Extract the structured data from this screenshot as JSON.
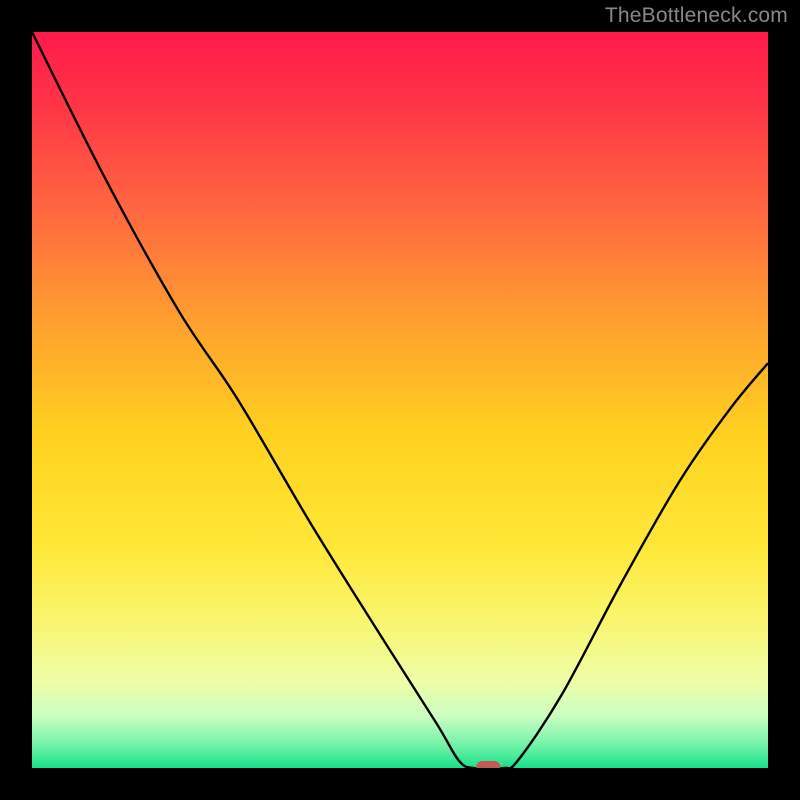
{
  "watermark": "TheBottleneck.com",
  "chart_data": {
    "type": "line",
    "title": "",
    "xlabel": "",
    "ylabel": "",
    "xlim": [
      0,
      100
    ],
    "ylim": [
      0,
      100
    ],
    "grid": false,
    "legend": false,
    "curve": [
      {
        "x": 0,
        "y": 100
      },
      {
        "x": 10,
        "y": 80
      },
      {
        "x": 20,
        "y": 62
      },
      {
        "x": 28,
        "y": 50
      },
      {
        "x": 38,
        "y": 33
      },
      {
        "x": 48,
        "y": 17
      },
      {
        "x": 55,
        "y": 6
      },
      {
        "x": 58,
        "y": 1
      },
      {
        "x": 60,
        "y": 0
      },
      {
        "x": 64,
        "y": 0
      },
      {
        "x": 66,
        "y": 1
      },
      {
        "x": 72,
        "y": 10
      },
      {
        "x": 80,
        "y": 25
      },
      {
        "x": 88,
        "y": 39
      },
      {
        "x": 95,
        "y": 49
      },
      {
        "x": 100,
        "y": 55
      }
    ],
    "marker": {
      "x": 62,
      "y": 0
    },
    "gradient_stops": [
      {
        "offset": 0.0,
        "color": "#ff1a4d"
      },
      {
        "offset": 0.1,
        "color": "#ff3545"
      },
      {
        "offset": 0.25,
        "color": "#ff6a3f"
      },
      {
        "offset": 0.4,
        "color": "#ffa22e"
      },
      {
        "offset": 0.55,
        "color": "#ffd21f"
      },
      {
        "offset": 0.7,
        "color": "#ffe838"
      },
      {
        "offset": 0.8,
        "color": "#f8f66f"
      },
      {
        "offset": 0.88,
        "color": "#f0fda6"
      },
      {
        "offset": 0.93,
        "color": "#caffc1"
      },
      {
        "offset": 0.97,
        "color": "#6ff2a8"
      },
      {
        "offset": 1.0,
        "color": "#17e08a"
      }
    ],
    "marker_color": "#c15a55",
    "curve_color": "#000000"
  }
}
